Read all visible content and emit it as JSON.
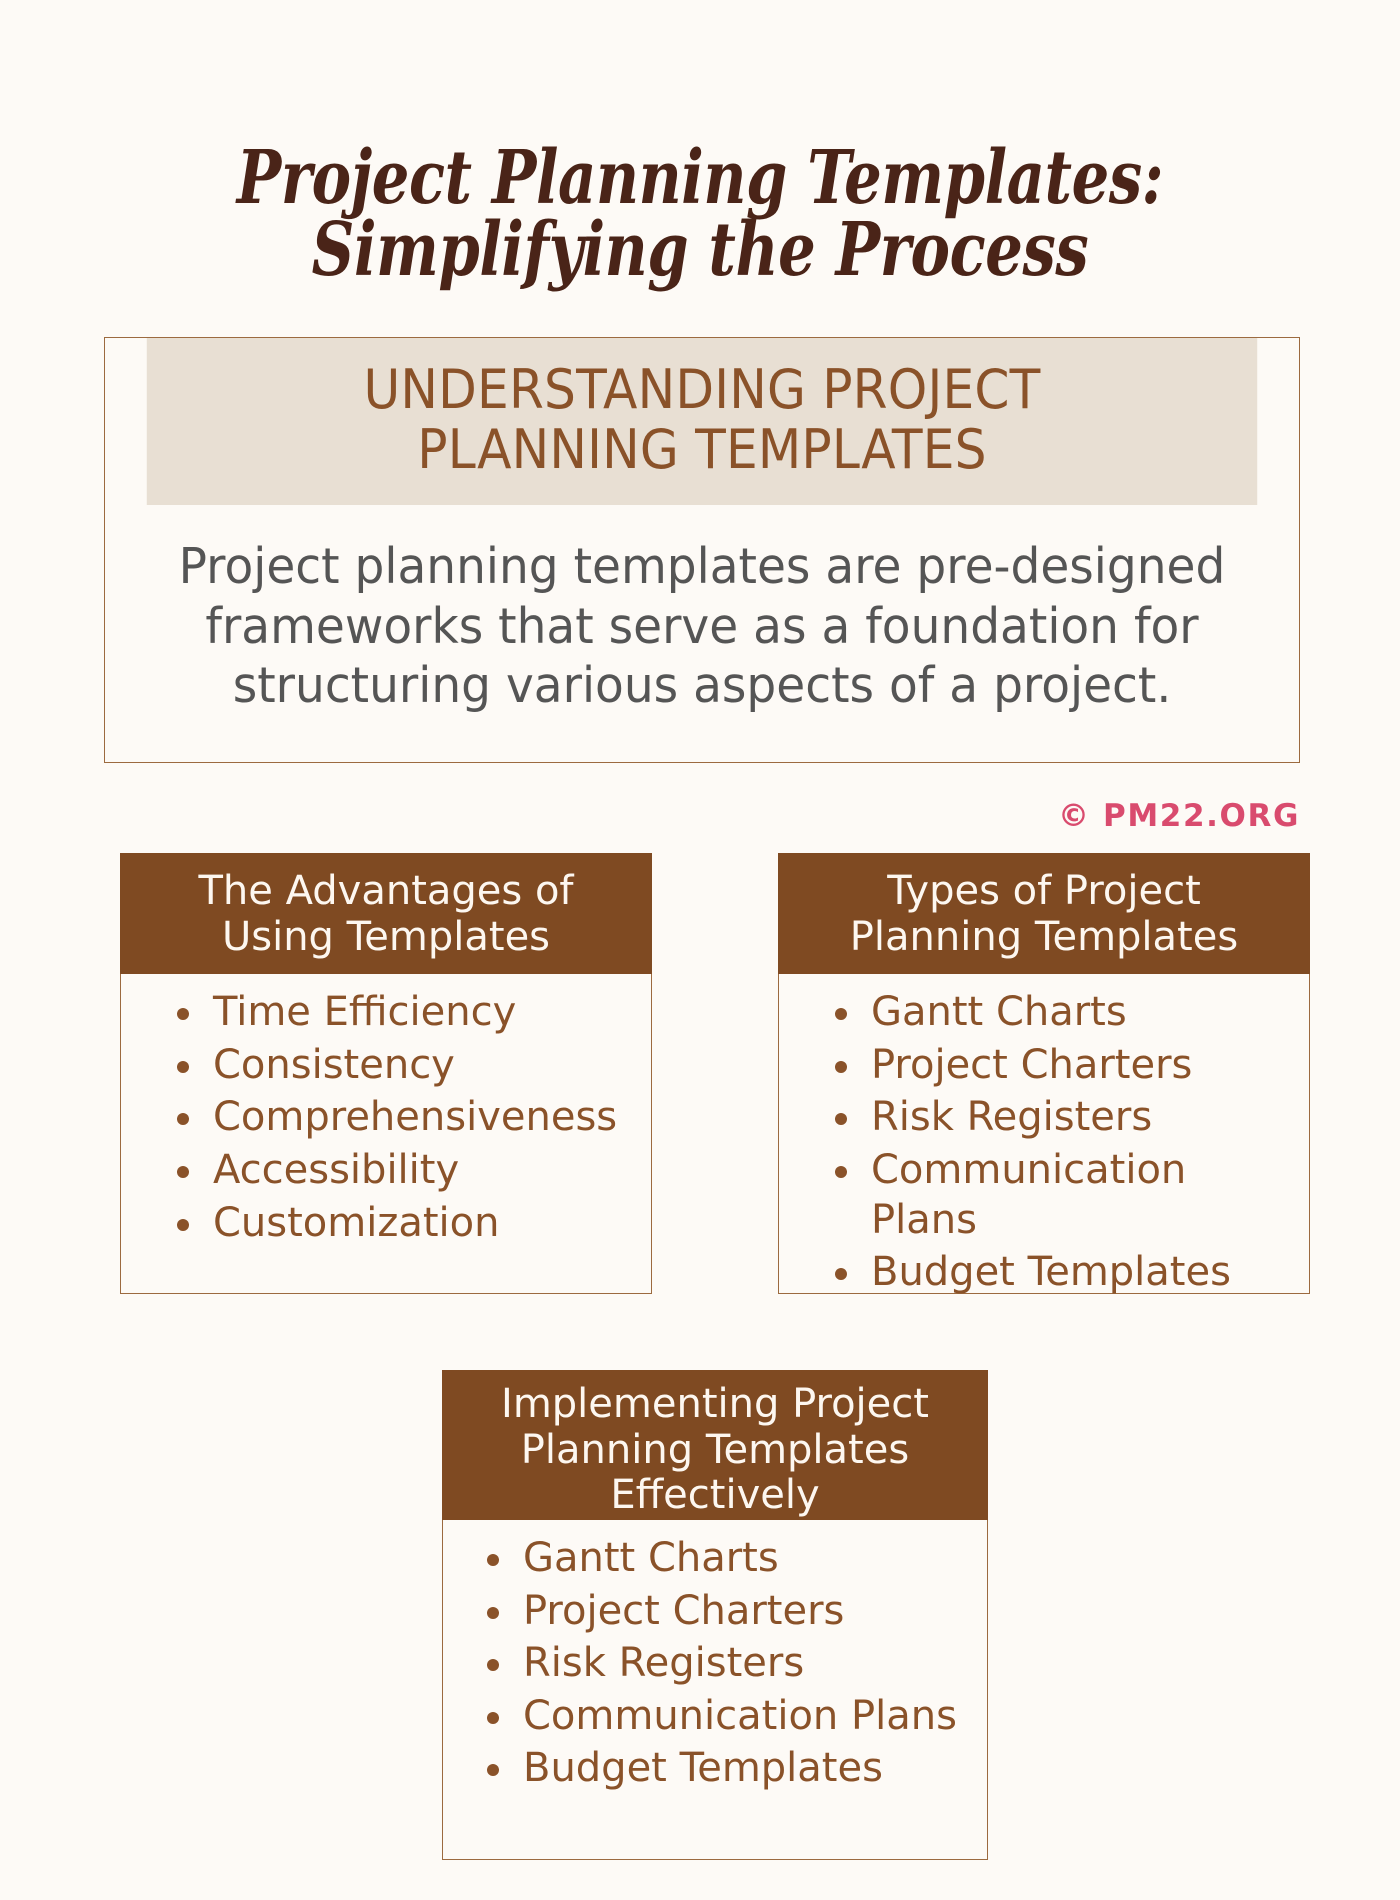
{
  "title": {
    "line1": "Project Planning Templates:",
    "line2": "Simplifying the Process"
  },
  "intro": {
    "heading_line1": "UNDERSTANDING PROJECT",
    "heading_line2": "PLANNING TEMPLATES",
    "body": "Project planning templates are pre-designed frameworks that serve as a foundation for structuring various aspects of a project."
  },
  "watermark": {
    "text": "© PM22.ORG"
  },
  "cards": [
    {
      "id": "advantages",
      "heading_line1": "The Advantages of",
      "heading_line2": "Using Templates",
      "items": [
        "Time Efficiency",
        "Consistency",
        "Comprehensiveness",
        "Accessibility",
        "Customization"
      ]
    },
    {
      "id": "types",
      "heading_line1": "Types of Project",
      "heading_line2": "Planning Templates",
      "items": [
        "Gantt Charts",
        "Project Charters",
        "Risk Registers",
        "Communication Plans",
        "Budget Templates"
      ]
    },
    {
      "id": "implementing",
      "heading_line1": "Implementing Project",
      "heading_line2": "Planning Templates",
      "heading_line3": "Effectively",
      "items": [
        "Gantt Charts",
        "Project Charters",
        "Risk Registers",
        "Communication Plans",
        "Budget Templates"
      ]
    }
  ],
  "colors": {
    "background": "#fdfaf6",
    "title_text": "#4a2418",
    "brand_brown": "#7f4a22",
    "accent_brown": "#8a5229",
    "beige_band": "#e8dfd3",
    "body_text": "#555555",
    "watermark": "#d94b6e",
    "border": "#9c6a3f"
  }
}
